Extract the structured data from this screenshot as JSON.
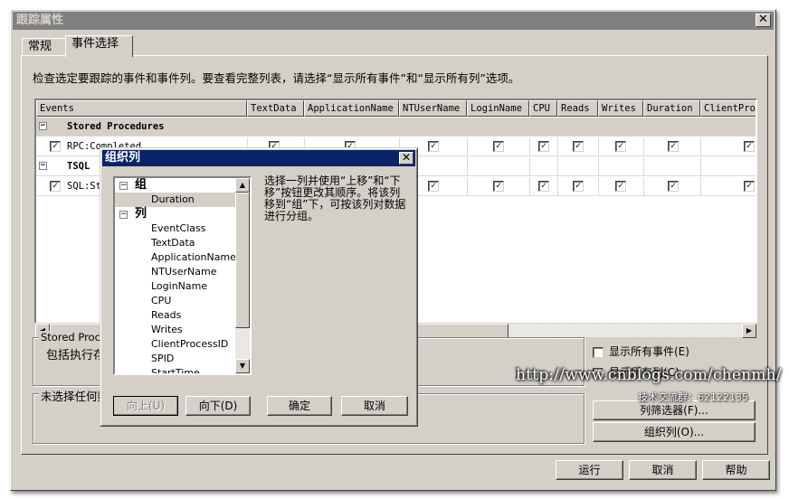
{
  "window": {
    "title": "跟踪属性",
    "close_icon": "close-icon"
  },
  "tabs": [
    {
      "label": "常规",
      "active": false
    },
    {
      "label": "事件选择",
      "active": true
    }
  ],
  "instructions": "检查选定要跟踪的事件和事件列。要查看完整列表，请选择“显示所有事件”和“显示所有列”选项。",
  "grid": {
    "columns": [
      "Events",
      "TextData",
      "ApplicationName",
      "NTUserName",
      "LoginName",
      "CPU",
      "Reads",
      "Writes",
      "Duration",
      "ClientProc"
    ],
    "rows": [
      {
        "type": "category",
        "label": "Stored Procedures",
        "expander": "−"
      },
      {
        "type": "event",
        "label": "RPC:Completed",
        "checked": true,
        "cells": [
          true,
          true,
          true,
          true,
          true,
          true,
          true,
          true,
          true
        ]
      },
      {
        "type": "category",
        "label": "TSQL",
        "expander": "−"
      },
      {
        "type": "event",
        "label": "SQL:StmtCompleted",
        "visible_label": "SQL:St",
        "checked": true,
        "cells": [
          true,
          true,
          true,
          true,
          true,
          true,
          true,
          true,
          true
        ]
      }
    ]
  },
  "description_group": {
    "label": "Stored Procedures",
    "text": "包括执行存"
  },
  "column_group": {
    "label": "未选择任何数"
  },
  "options": {
    "show_all_events": {
      "label": "显示所有事件(E)",
      "checked": false
    },
    "show_all_columns": {
      "label": "显示所有列(C)",
      "checked": false
    }
  },
  "side_buttons": {
    "column_filters": "列筛选器(F)...",
    "organize_columns": "组织列(O)..."
  },
  "footer_buttons": {
    "run": "运行",
    "cancel": "取消",
    "help": "帮助"
  },
  "modal": {
    "title": "组织列",
    "groups_heading": "组",
    "groups": [
      "Duration"
    ],
    "columns_heading": "列",
    "columns": [
      "EventClass",
      "TextData",
      "ApplicationName",
      "NTUserName",
      "LoginName",
      "CPU",
      "Reads",
      "Writes",
      "ClientProcessID",
      "SPID",
      "StartTime"
    ],
    "help_text": "选择一列并使用“上移”和“下移”按钮更改其顺序。将该列移到“组”下，可按该列对数据进行分组。",
    "buttons": {
      "up": "向上(U)",
      "down": "向下(D)",
      "ok": "确定",
      "cancel": "取消"
    }
  },
  "watermark": {
    "url": "http://www.cnblogs.com/chenmh/",
    "group": "技术交流群：62122135"
  }
}
